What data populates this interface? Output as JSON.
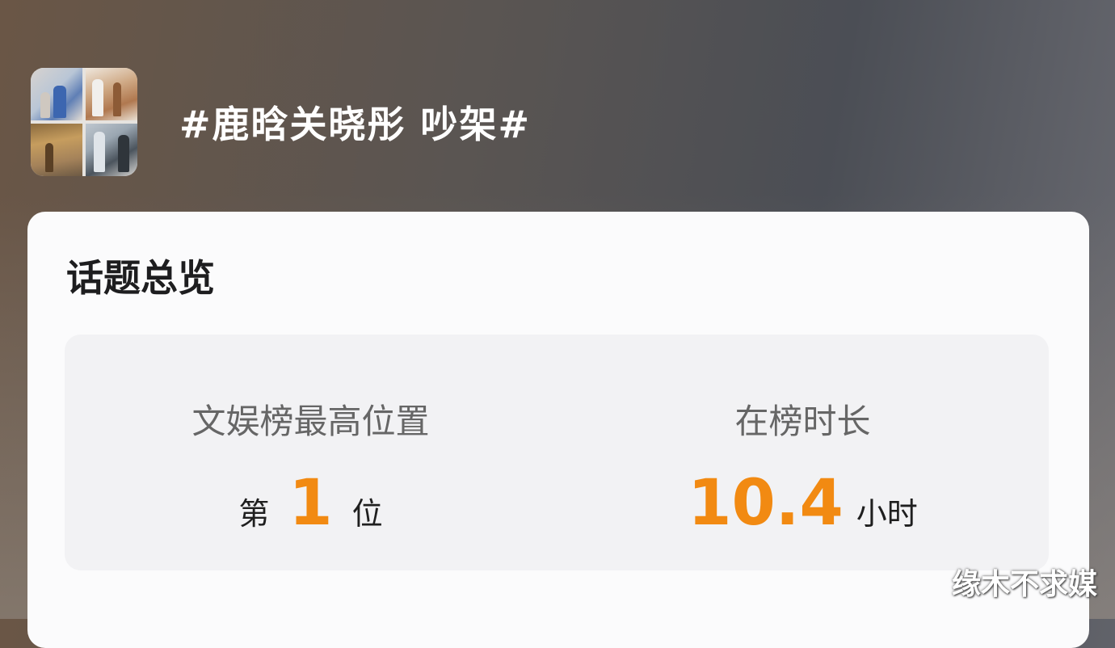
{
  "topic": {
    "title": "#鹿晗关晓彤 吵架#"
  },
  "overview": {
    "heading": "话题总览",
    "stats": [
      {
        "label": "文娱榜最高位置",
        "prefix": "第",
        "value": "1",
        "suffix": "位"
      },
      {
        "label": "在榜时长",
        "prefix": "",
        "value": "10.4",
        "suffix": "小时"
      }
    ]
  },
  "watermark": "缘木不求媒",
  "colors": {
    "accent": "#f28a12",
    "card_bg": "#fbfbfc",
    "stats_bg": "#f2f2f4"
  }
}
